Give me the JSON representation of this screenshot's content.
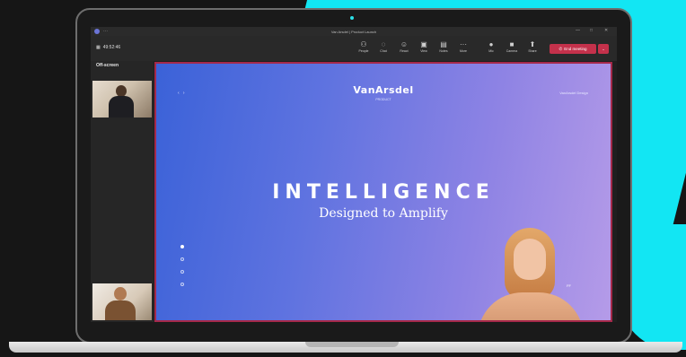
{
  "window": {
    "title": "Van Arsdel | Product Launch"
  },
  "toolbar": {
    "timer": "49:52:46",
    "buttons": [
      {
        "label": "People",
        "icon": "people-icon"
      },
      {
        "label": "Chat",
        "icon": "chat-icon"
      },
      {
        "label": "React",
        "icon": "react-icon"
      },
      {
        "label": "View",
        "icon": "view-icon"
      },
      {
        "label": "Notes",
        "icon": "notes-icon"
      },
      {
        "label": "More",
        "icon": "more-icon"
      },
      {
        "label": "Mic",
        "icon": "mic-icon"
      },
      {
        "label": "Camera",
        "icon": "camera-icon"
      },
      {
        "label": "Share",
        "icon": "share-icon"
      }
    ],
    "end_meeting": "End meeting"
  },
  "sidebar": {
    "title": "Off-screen"
  },
  "slide": {
    "brand": "VanArsdel",
    "brand_sub": "PRODUCT",
    "corner": "VanArsdel Design",
    "headline": "INTELLIGENCE",
    "subline": "Designed to Amplify",
    "presenter_tag": "FF"
  },
  "colors": {
    "accent": "#12e6f3",
    "end": "#c4314b",
    "frame": "#a5294a"
  }
}
